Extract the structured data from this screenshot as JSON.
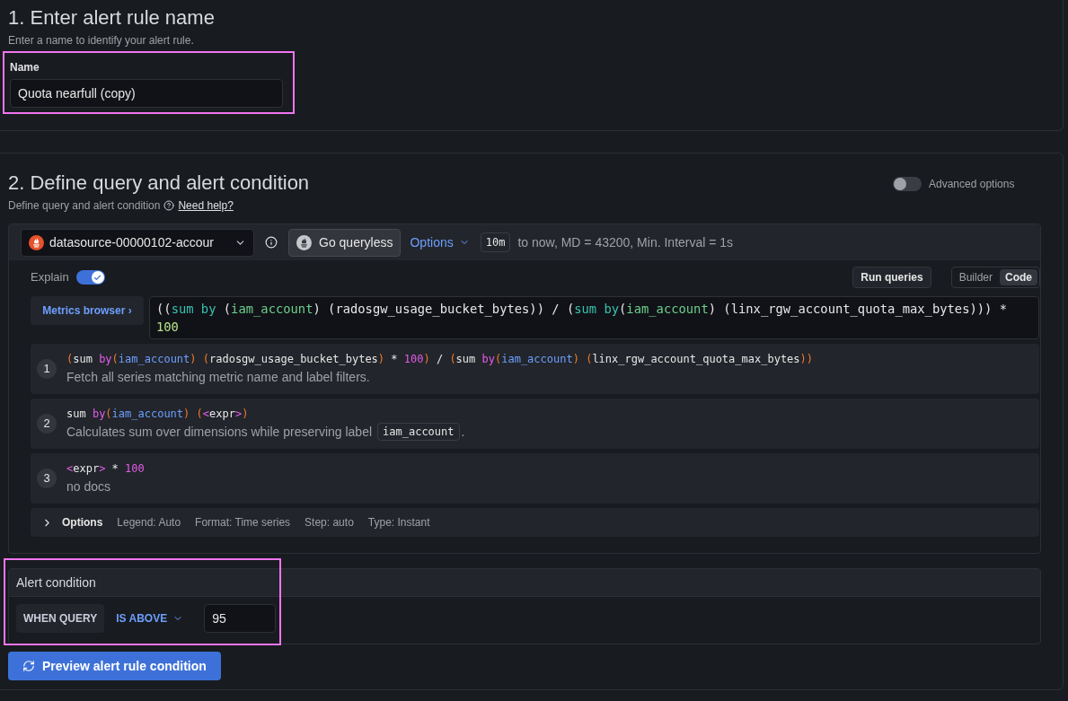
{
  "section_1": {
    "title": "1. Enter alert rule name",
    "subtitle": "Enter a name to identify your alert rule.",
    "highlighted": true,
    "field_label": "Name",
    "field_value": "Quota nearfull (copy)"
  },
  "section_2": {
    "title": "2. Define query and alert condition",
    "subtitle": "Define query and alert condition",
    "help_link": "Need help?",
    "advanced_options": {
      "label": "Advanced options",
      "on": false
    },
    "query_editor": {
      "datasource": "datasource-00000102-accour",
      "go_queryless": "Go queryless",
      "options_link": "Options",
      "interval_badge": "10m",
      "query_info": "to now, MD = 43200, Min. Interval = 1s",
      "explain": {
        "label": "Explain",
        "on": true
      },
      "run_queries": "Run queries",
      "modes": [
        {
          "label": "Builder",
          "selected": false
        },
        {
          "label": "Code",
          "selected": true
        }
      ],
      "metrics_browser": "Metrics browser ›",
      "query": [
        {
          "kind": "plain",
          "text": "(("
        },
        {
          "kind": "func",
          "text": "sum by"
        },
        {
          "kind": "plain",
          "text": " ("
        },
        {
          "kind": "label",
          "text": "iam_account"
        },
        {
          "kind": "plain",
          "text": ") (radosgw_usage_bucket_bytes)) / ("
        },
        {
          "kind": "func",
          "text": "sum by"
        },
        {
          "kind": "plain",
          "text": "("
        },
        {
          "kind": "label",
          "text": "iam_account"
        },
        {
          "kind": "plain",
          "text": ") (linx_rgw_account_quota_max_bytes))) * "
        },
        {
          "kind": "number",
          "text": "100"
        }
      ],
      "steps": [
        {
          "number": "1",
          "code": [
            {
              "kind": "paren",
              "text": "("
            },
            {
              "kind": "plain",
              "text": "sum "
            },
            {
              "kind": "keyword",
              "text": "by"
            },
            {
              "kind": "paren",
              "text": "("
            },
            {
              "kind": "label",
              "text": "iam_account"
            },
            {
              "kind": "paren",
              "text": ") ("
            },
            {
              "kind": "plain",
              "text": "radosgw_usage_bucket_bytes"
            },
            {
              "kind": "paren",
              "text": ")"
            },
            {
              "kind": "plain",
              "text": " * "
            },
            {
              "kind": "number",
              "text": "100"
            },
            {
              "kind": "paren",
              "text": ")"
            },
            {
              "kind": "plain",
              "text": " / "
            },
            {
              "kind": "paren",
              "text": "("
            },
            {
              "kind": "plain",
              "text": "sum "
            },
            {
              "kind": "keyword",
              "text": "by"
            },
            {
              "kind": "paren",
              "text": "("
            },
            {
              "kind": "label",
              "text": "iam_account"
            },
            {
              "kind": "paren",
              "text": ") ("
            },
            {
              "kind": "plain",
              "text": "linx_rgw_account_quota_max_bytes"
            },
            {
              "kind": "paren",
              "text": "))"
            }
          ],
          "description": "Fetch all series matching metric name and label filters."
        },
        {
          "number": "2",
          "code": [
            {
              "kind": "plain",
              "text": "sum "
            },
            {
              "kind": "keyword",
              "text": "by"
            },
            {
              "kind": "paren",
              "text": "("
            },
            {
              "kind": "label",
              "text": "iam_account"
            },
            {
              "kind": "paren",
              "text": ") ("
            },
            {
              "kind": "keyword",
              "text": "<"
            },
            {
              "kind": "plain",
              "text": "expr"
            },
            {
              "kind": "keyword",
              "text": ">"
            },
            {
              "kind": "paren",
              "text": ")"
            }
          ],
          "description": "Calculates sum over dimensions while preserving label",
          "chip": "iam_account",
          "description_end": "."
        },
        {
          "number": "3",
          "code": [
            {
              "kind": "keyword",
              "text": "<"
            },
            {
              "kind": "plain",
              "text": "expr"
            },
            {
              "kind": "keyword",
              "text": ">"
            },
            {
              "kind": "plain",
              "text": " * "
            },
            {
              "kind": "number",
              "text": "100"
            }
          ],
          "description": "no docs"
        }
      ],
      "options_row": {
        "label": "Options",
        "items": [
          "Legend: Auto",
          "Format: Time series",
          "Step: auto",
          "Type: Instant"
        ]
      }
    },
    "alert_condition": {
      "title": "Alert condition",
      "highlighted": true,
      "when": "WHEN QUERY",
      "operator": "IS ABOVE",
      "threshold": "95"
    },
    "preview_button": "Preview alert rule condition"
  }
}
